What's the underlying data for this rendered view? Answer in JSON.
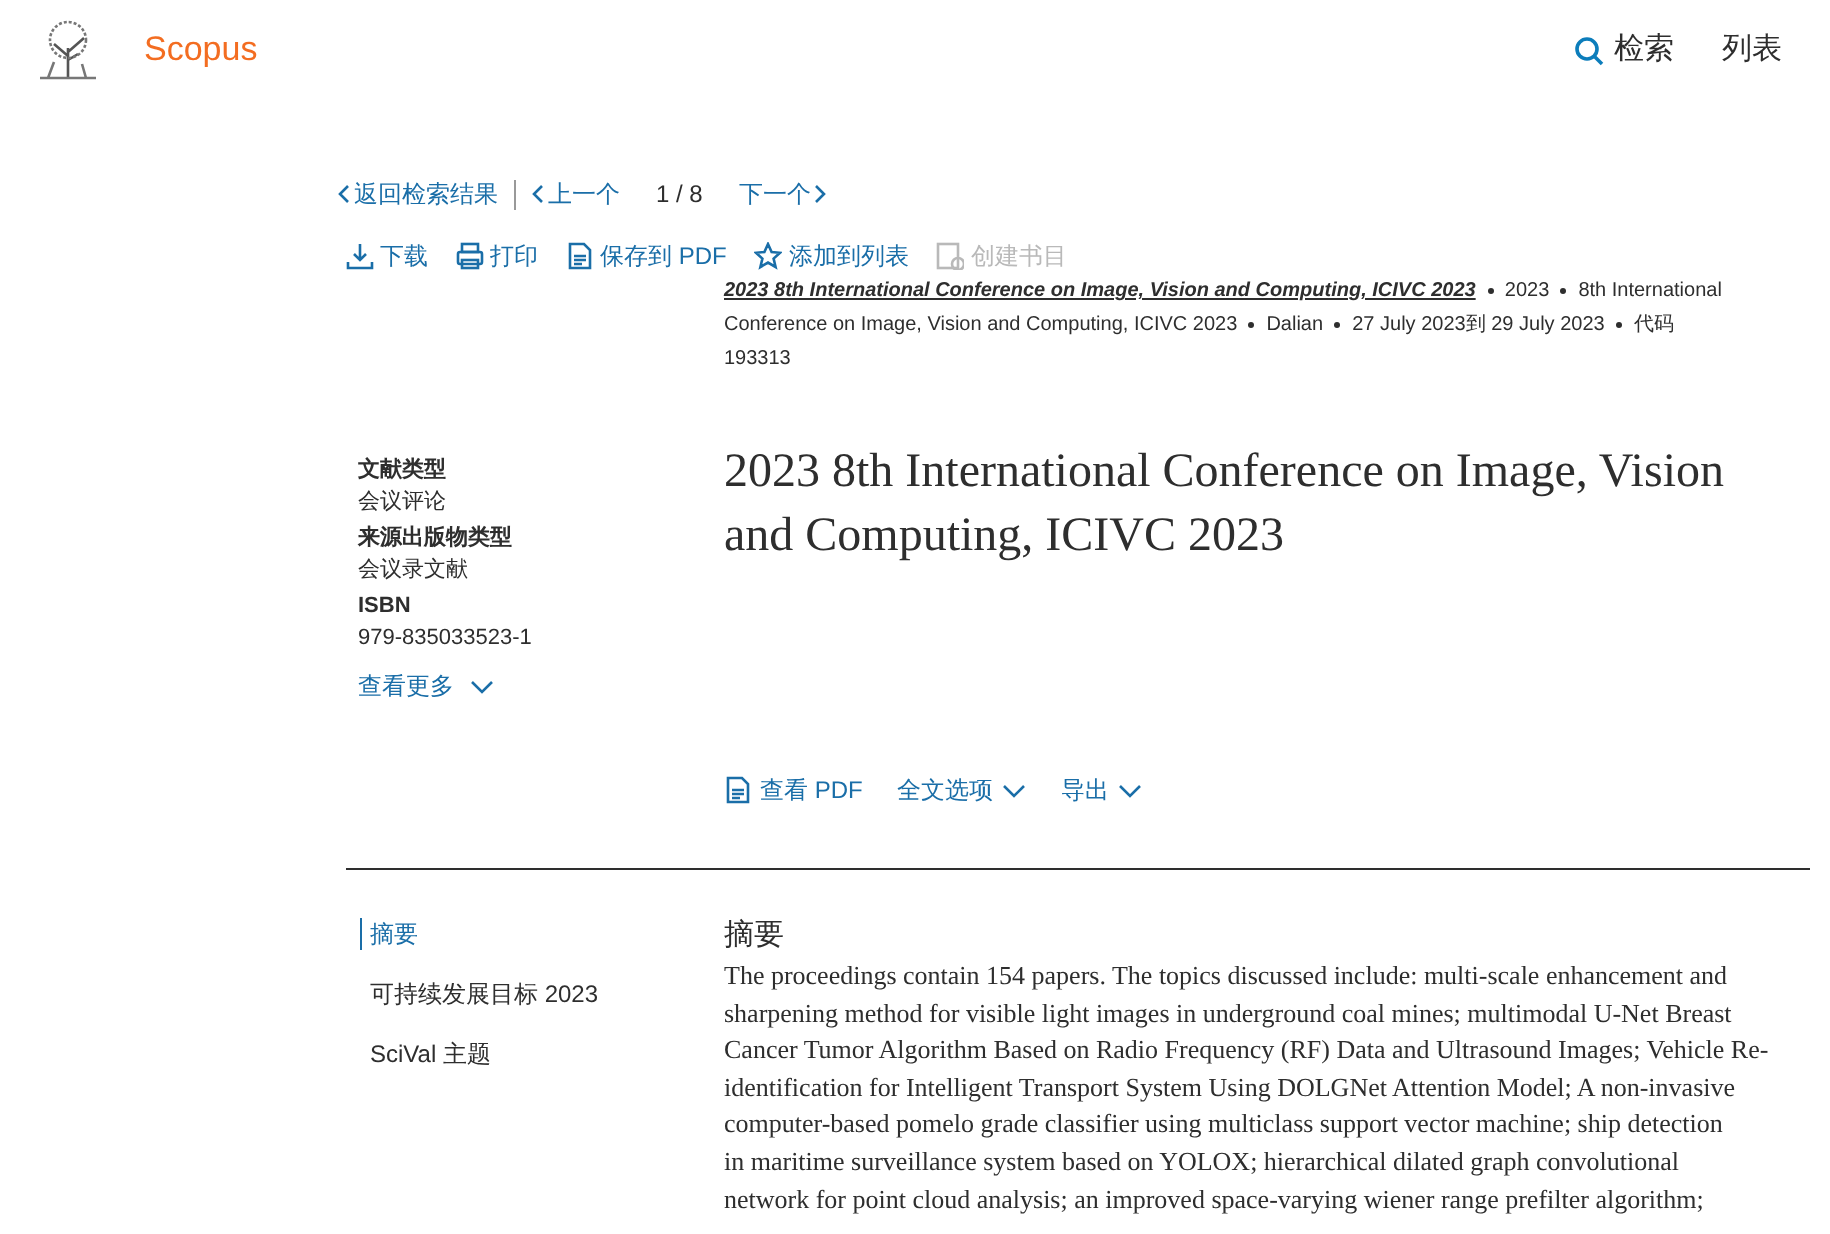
{
  "header": {
    "logo_text": "Scopus",
    "nav": [
      {
        "label": "检索",
        "kind": "search"
      },
      {
        "label": "列表",
        "kind": "plain"
      }
    ]
  },
  "pager": {
    "back": "返回检索结果",
    "prev": "上一个",
    "position": "1 / 8",
    "next": "下一个"
  },
  "actions": [
    {
      "label": "下载",
      "kind": "download",
      "disabled": false
    },
    {
      "label": "打印",
      "kind": "print",
      "disabled": false
    },
    {
      "label": "保存到 PDF",
      "kind": "pdf",
      "disabled": false
    },
    {
      "label": "添加到列表",
      "kind": "star",
      "disabled": false
    },
    {
      "label": "创建书目",
      "kind": "bibliography",
      "disabled": true
    }
  ],
  "source": {
    "title": "2023 8th International Conference on Image, Vision and Computing, ICIVC 2023",
    "details": [
      "2023",
      "8th International Conference on Image, Vision and Computing, ICIVC 2023",
      "Dalian",
      "27 July 2023到 29 July 2023",
      "代码 193313"
    ]
  },
  "metadata": [
    {
      "label": "文献类型",
      "value": "会议评论"
    },
    {
      "label": "来源出版物类型",
      "value": "会议录文献"
    },
    {
      "label": "ISBN",
      "value": "979-835033523-1"
    }
  ],
  "show_more": "查看更多",
  "title": "2023 8th International Conference on Image, Vision and Computing, ICIVC 2023",
  "doc_actions": [
    {
      "label": "查看 PDF",
      "kind": "pdf"
    },
    {
      "label": "全文选项",
      "kind": "dropdown"
    },
    {
      "label": "导出",
      "kind": "dropdown"
    }
  ],
  "toc": [
    {
      "label": "摘要",
      "selected": true
    },
    {
      "label": "可持续发展目标 2023",
      "selected": false
    },
    {
      "label": "SciVal 主题",
      "selected": false
    }
  ],
  "abstract": {
    "heading": "摘要",
    "lines": [
      "The proceedings contain 154 papers. The topics discussed include: multi-scale enhancement and",
      "sharpening method for visible light images in underground coal mines; multimodal U-Net Breast",
      "Cancer Tumor Algorithm Based on Radio Frequency (RF) Data and Ultrasound Images; Vehicle Re-",
      "identification for Intelligent Transport System Using DOLGNet Attention Model; A non-invasive",
      "computer-based pomelo grade classifier using multiclass support vector machine; ship detection",
      "in maritime surveillance system based on YOLOX; hierarchical dilated graph convolutional",
      "network for point cloud analysis; an improved space-varying wiener range prefilter algorithm;"
    ]
  }
}
